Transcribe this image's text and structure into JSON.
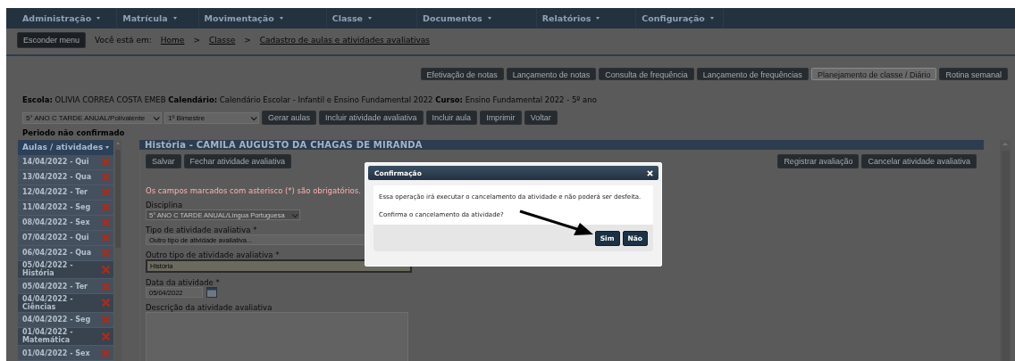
{
  "nav_menu": [
    {
      "label": "Administração"
    },
    {
      "label": "Matrícula"
    },
    {
      "label": "Movimentação"
    },
    {
      "label": "Classe"
    },
    {
      "label": "Documentos"
    },
    {
      "label": "Relatórios"
    },
    {
      "label": "Configuração"
    }
  ],
  "breadcrumb": {
    "hide_menu_button": "Esconder menu",
    "prefix": "Você está em:",
    "items": [
      {
        "kind": "link",
        "text": "Home"
      },
      {
        "kind": "separator",
        "text": ">"
      },
      {
        "kind": "link",
        "text": "Classe"
      },
      {
        "kind": "separator",
        "text": ">"
      },
      {
        "kind": "link",
        "text": "Cadastro de aulas e atividades avaliativas"
      }
    ]
  },
  "top_buttons": [
    {
      "label": "Efetivação de notas",
      "disabled": false
    },
    {
      "label": "Lançamento de notas",
      "disabled": false
    },
    {
      "label": "Consulta de frequência",
      "disabled": false
    },
    {
      "label": "Lançamento de frequências",
      "disabled": false
    },
    {
      "label": "Planejamento de classe / Diário",
      "disabled": true
    },
    {
      "label": "Rotina semanal",
      "disabled": false
    }
  ],
  "school_info": "**Escola:** OLIVIA CORREA COSTA EMEB **Calendário:** Calendário Escolar - Infantil e Ensino Fundamental 2022 **Curso:** Ensino Fundamental 2022 - 5º ano",
  "filters": [
    {
      "value": "5° ANO C TARDE ANUAL/Polivalente"
    },
    {
      "value": "1º Bimestre"
    }
  ],
  "actions": [
    "Gerar aulas",
    "Incluir atividade avaliativa",
    "Incluir aula",
    "Imprimir",
    "Voltar"
  ],
  "period_status": "Periodo não confirmado",
  "sidebar": {
    "title": "Aulas / atividades",
    "items": [
      {
        "label": "14/04/2022 - Qui",
        "kind": "lesson"
      },
      {
        "label": "13/04/2022 - Qua",
        "kind": "lesson"
      },
      {
        "label": "12/04/2022 - Ter",
        "kind": "lesson"
      },
      {
        "label": "11/04/2022 - Seg",
        "kind": "lesson"
      },
      {
        "label": "08/04/2022 - Sex",
        "kind": "lesson"
      },
      {
        "label": "07/04/2022 - Qui",
        "kind": "lesson"
      },
      {
        "label": "06/04/2022 - Qua",
        "kind": "lesson"
      },
      {
        "label": "05/04/2022 - História",
        "kind": "activity"
      },
      {
        "label": "05/04/2022 - Ter",
        "kind": "lesson"
      },
      {
        "label": "04/04/2022 - Ciências",
        "kind": "activity"
      },
      {
        "label": "04/04/2022 - Seg",
        "kind": "lesson"
      },
      {
        "label": "01/04/2022 - Matemática",
        "kind": "activity"
      },
      {
        "label": "01/04/2022 - Sex",
        "kind": "lesson"
      }
    ]
  },
  "panel": {
    "title": "História - CAMILA AUGUSTO DA CHAGAS DE MIRANDA",
    "left_buttons": [
      "Salvar",
      "Fechar atividade avaliativa"
    ],
    "right_buttons": [
      "Registrar avaliação",
      "Cancelar atividade avaliativa"
    ],
    "required_note": "Os campos marcados com asterisco (*) são obrigatórios.",
    "fields": [
      {
        "kind": "select",
        "label": "Disciplina",
        "value": "5° ANO C TARDE ANUAL/Língua Portuguesa",
        "disabled": true,
        "focused": false
      },
      {
        "kind": "text",
        "label": "Tipo de atividade avaliativa *",
        "value": "Outro tipo de atividade avaliativa...",
        "disabled": false,
        "focused": false
      },
      {
        "kind": "text",
        "label": "Outro tipo de atividade avaliativa *",
        "value": "História",
        "disabled": false,
        "focused": true
      },
      {
        "kind": "date",
        "label": "Data da atividade *",
        "value": "05/04/2022",
        "disabled": false,
        "focused": false
      },
      {
        "kind": "textarea",
        "label": "Descrição da atividade avaliativa",
        "disabled": false,
        "focused": false
      }
    ]
  },
  "dialog": {
    "title": "Confirmação",
    "message": "Essa operação irá executar o cancelamento da atividade e não poderá ser desfeita.",
    "question": "Confirma o cancelamento da atividade?",
    "buttons": [
      "Sim",
      "Não"
    ]
  }
}
